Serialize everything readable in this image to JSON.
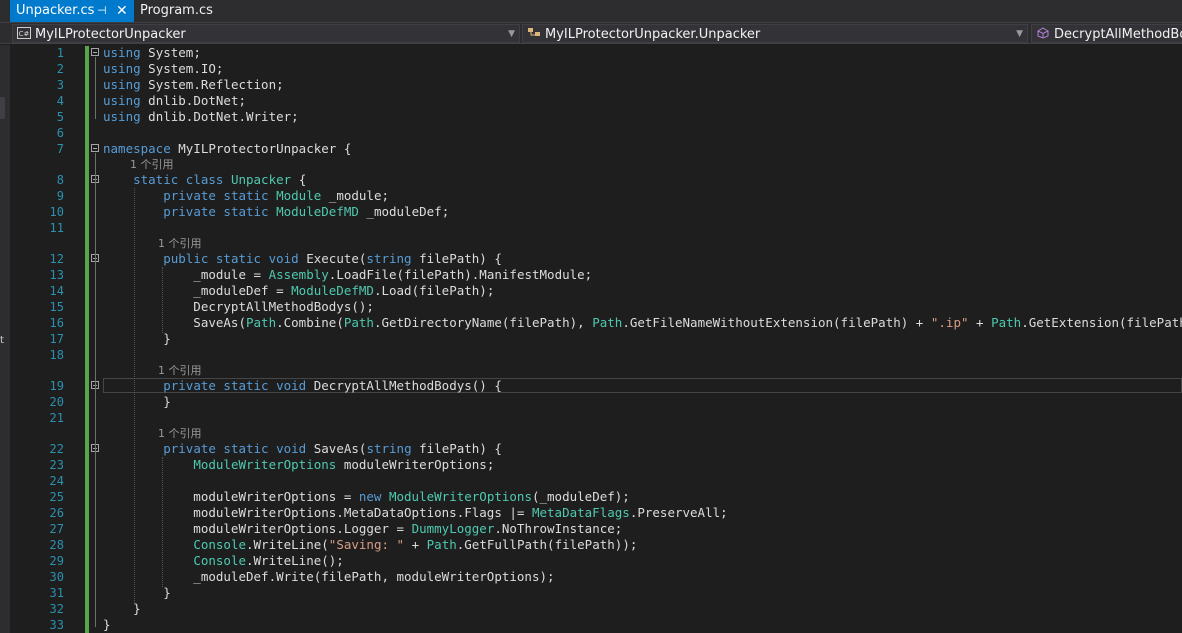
{
  "tabs": [
    {
      "label": "Unpacker.cs",
      "active": true,
      "pin": "⊣",
      "close": "✕"
    },
    {
      "label": "Program.cs",
      "active": false
    }
  ],
  "navbar": {
    "project": "MyILProtectorUnpacker",
    "class": "MyILProtectorUnpacker.Unpacker",
    "member": "DecryptAllMethodBodys()"
  },
  "left_strip_text": "t",
  "colors": {
    "keyword": "#569cd6",
    "type": "#4ec9b0",
    "string": "#d69d85",
    "text": "#dcdcdc",
    "line_number": "#2b91af",
    "codelens": "#999999",
    "changes_bar": "#57a64a",
    "active_tab": "#007acc"
  },
  "code_lines": [
    {
      "num": "1",
      "fold": true,
      "tokens": [
        [
          "kw",
          "using"
        ],
        [
          "tx",
          " System;"
        ]
      ]
    },
    {
      "num": "2",
      "tokens": [
        [
          "kw",
          "using"
        ],
        [
          "tx",
          " System.IO;"
        ]
      ]
    },
    {
      "num": "3",
      "tokens": [
        [
          "kw",
          "using"
        ],
        [
          "tx",
          " System.Reflection;"
        ]
      ]
    },
    {
      "num": "4",
      "tokens": [
        [
          "kw",
          "using"
        ],
        [
          "tx",
          " dnlib.DotNet;"
        ]
      ]
    },
    {
      "num": "5",
      "tokens": [
        [
          "kw",
          "using"
        ],
        [
          "tx",
          " dnlib.DotNet.Writer;"
        ]
      ]
    },
    {
      "num": "6",
      "tokens": []
    },
    {
      "num": "7",
      "fold": true,
      "tokens": [
        [
          "kw",
          "namespace"
        ],
        [
          "tx",
          " MyILProtectorUnpacker {"
        ]
      ]
    },
    {
      "ref": "1 个引用",
      "indent": 1
    },
    {
      "num": "8",
      "fold": true,
      "tokens": [
        [
          "tx",
          "    "
        ],
        [
          "kw",
          "static class"
        ],
        [
          "tx",
          " "
        ],
        [
          "ty",
          "Unpacker"
        ],
        [
          "tx",
          " {"
        ]
      ]
    },
    {
      "num": "9",
      "tokens": [
        [
          "tx",
          "        "
        ],
        [
          "kw",
          "private static"
        ],
        [
          "tx",
          " "
        ],
        [
          "ty",
          "Module"
        ],
        [
          "tx",
          " _module;"
        ]
      ]
    },
    {
      "num": "10",
      "tokens": [
        [
          "tx",
          "        "
        ],
        [
          "kw",
          "private static"
        ],
        [
          "tx",
          " "
        ],
        [
          "ty",
          "ModuleDefMD"
        ],
        [
          "tx",
          " _moduleDef;"
        ]
      ]
    },
    {
      "num": "11",
      "tokens": []
    },
    {
      "ref": "1 个引用",
      "indent": 2
    },
    {
      "num": "12",
      "fold": true,
      "tokens": [
        [
          "tx",
          "        "
        ],
        [
          "kw",
          "public static void"
        ],
        [
          "tx",
          " Execute("
        ],
        [
          "kw",
          "string"
        ],
        [
          "tx",
          " filePath) {"
        ]
      ]
    },
    {
      "num": "13",
      "tokens": [
        [
          "tx",
          "            _module = "
        ],
        [
          "ty",
          "Assembly"
        ],
        [
          "tx",
          ".LoadFile(filePath).ManifestModule;"
        ]
      ]
    },
    {
      "num": "14",
      "tokens": [
        [
          "tx",
          "            _moduleDef = "
        ],
        [
          "ty",
          "ModuleDefMD"
        ],
        [
          "tx",
          ".Load(filePath);"
        ]
      ]
    },
    {
      "num": "15",
      "tokens": [
        [
          "tx",
          "            DecryptAllMethodBodys();"
        ]
      ]
    },
    {
      "num": "16",
      "tokens": [
        [
          "tx",
          "            SaveAs("
        ],
        [
          "ty",
          "Path"
        ],
        [
          "tx",
          ".Combine("
        ],
        [
          "ty",
          "Path"
        ],
        [
          "tx",
          ".GetDirectoryName(filePath), "
        ],
        [
          "ty",
          "Path"
        ],
        [
          "tx",
          ".GetFileNameWithoutExtension(filePath) + "
        ],
        [
          "st",
          "\".ip\""
        ],
        [
          "tx",
          " + "
        ],
        [
          "ty",
          "Path"
        ],
        [
          "tx",
          ".GetExtension(filePath)));"
        ]
      ]
    },
    {
      "num": "17",
      "tokens": [
        [
          "tx",
          "        }"
        ]
      ]
    },
    {
      "num": "18",
      "tokens": []
    },
    {
      "ref": "1 个引用",
      "indent": 2
    },
    {
      "num": "19",
      "fold": true,
      "current": true,
      "tokens": [
        [
          "tx",
          "        "
        ],
        [
          "kw",
          "private static void"
        ],
        [
          "tx",
          " DecryptAllMethodBodys() {"
        ]
      ]
    },
    {
      "num": "20",
      "tokens": [
        [
          "tx",
          "        }"
        ]
      ]
    },
    {
      "num": "21",
      "tokens": []
    },
    {
      "ref": "1 个引用",
      "indent": 2
    },
    {
      "num": "22",
      "fold": true,
      "tokens": [
        [
          "tx",
          "        "
        ],
        [
          "kw",
          "private static void"
        ],
        [
          "tx",
          " SaveAs("
        ],
        [
          "kw",
          "string"
        ],
        [
          "tx",
          " filePath) {"
        ]
      ]
    },
    {
      "num": "23",
      "tokens": [
        [
          "tx",
          "            "
        ],
        [
          "ty",
          "ModuleWriterOptions"
        ],
        [
          "tx",
          " moduleWriterOptions;"
        ]
      ]
    },
    {
      "num": "24",
      "tokens": []
    },
    {
      "num": "25",
      "tokens": [
        [
          "tx",
          "            moduleWriterOptions = "
        ],
        [
          "kw",
          "new"
        ],
        [
          "tx",
          " "
        ],
        [
          "ty",
          "ModuleWriterOptions"
        ],
        [
          "tx",
          "(_moduleDef);"
        ]
      ]
    },
    {
      "num": "26",
      "tokens": [
        [
          "tx",
          "            moduleWriterOptions.MetaDataOptions.Flags |= "
        ],
        [
          "ty",
          "MetaDataFlags"
        ],
        [
          "tx",
          ".PreserveAll;"
        ]
      ]
    },
    {
      "num": "27",
      "tokens": [
        [
          "tx",
          "            moduleWriterOptions.Logger = "
        ],
        [
          "ty",
          "DummyLogger"
        ],
        [
          "tx",
          ".NoThrowInstance;"
        ]
      ]
    },
    {
      "num": "28",
      "tokens": [
        [
          "tx",
          "            "
        ],
        [
          "ty",
          "Console"
        ],
        [
          "tx",
          ".WriteLine("
        ],
        [
          "st",
          "\"Saving: \""
        ],
        [
          "tx",
          " + "
        ],
        [
          "ty",
          "Path"
        ],
        [
          "tx",
          ".GetFullPath(filePath));"
        ]
      ]
    },
    {
      "num": "29",
      "tokens": [
        [
          "tx",
          "            "
        ],
        [
          "ty",
          "Console"
        ],
        [
          "tx",
          ".WriteLine();"
        ]
      ]
    },
    {
      "num": "30",
      "tokens": [
        [
          "tx",
          "            _moduleDef.Write(filePath, moduleWriterOptions);"
        ]
      ]
    },
    {
      "num": "31",
      "tokens": [
        [
          "tx",
          "        }"
        ]
      ]
    },
    {
      "num": "32",
      "tokens": [
        [
          "tx",
          "    }"
        ]
      ]
    },
    {
      "num": "33",
      "tokens": [
        [
          "tx",
          "}"
        ]
      ]
    }
  ]
}
